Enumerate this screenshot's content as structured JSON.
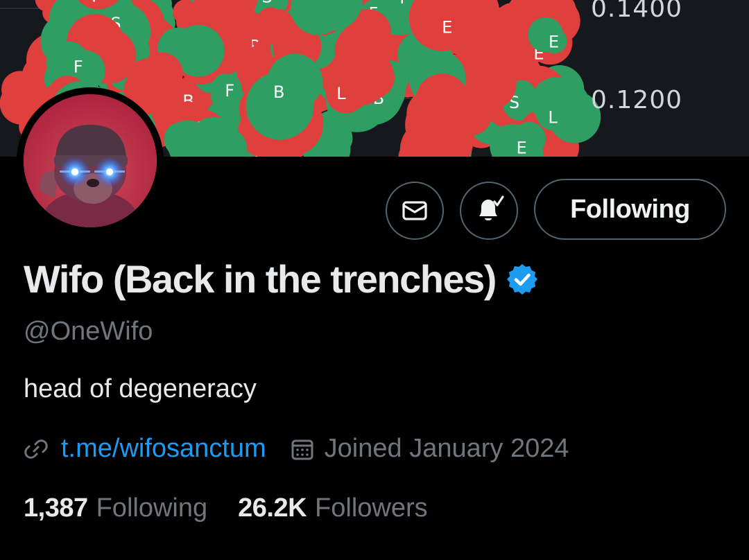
{
  "banner": {
    "price_ticks": [
      "0.1400",
      "0.1200"
    ],
    "colors": {
      "bg": "#15181c",
      "red": "#e0403d",
      "green": "#2f9e63"
    }
  },
  "profile": {
    "display_name": "Wifo (Back in the trenches)",
    "verified": true,
    "handle": "@OneWifo",
    "bio": "head of degeneracy",
    "link_text": "t.me/wifosanctum",
    "joined": "Joined January 2024",
    "following_count": "1,387",
    "following_label": "Following",
    "followers_count": "26.2K",
    "followers_label": "Followers"
  },
  "actions": {
    "message_icon": "envelope-icon",
    "bell_icon": "bell-check-icon",
    "follow_label": "Following"
  },
  "colors": {
    "background": "#000000",
    "primary_text": "#e7e9ea",
    "secondary_text": "#71767b",
    "link": "#1d9bf0",
    "verified": "#1d9bf0",
    "border": "#536471"
  }
}
